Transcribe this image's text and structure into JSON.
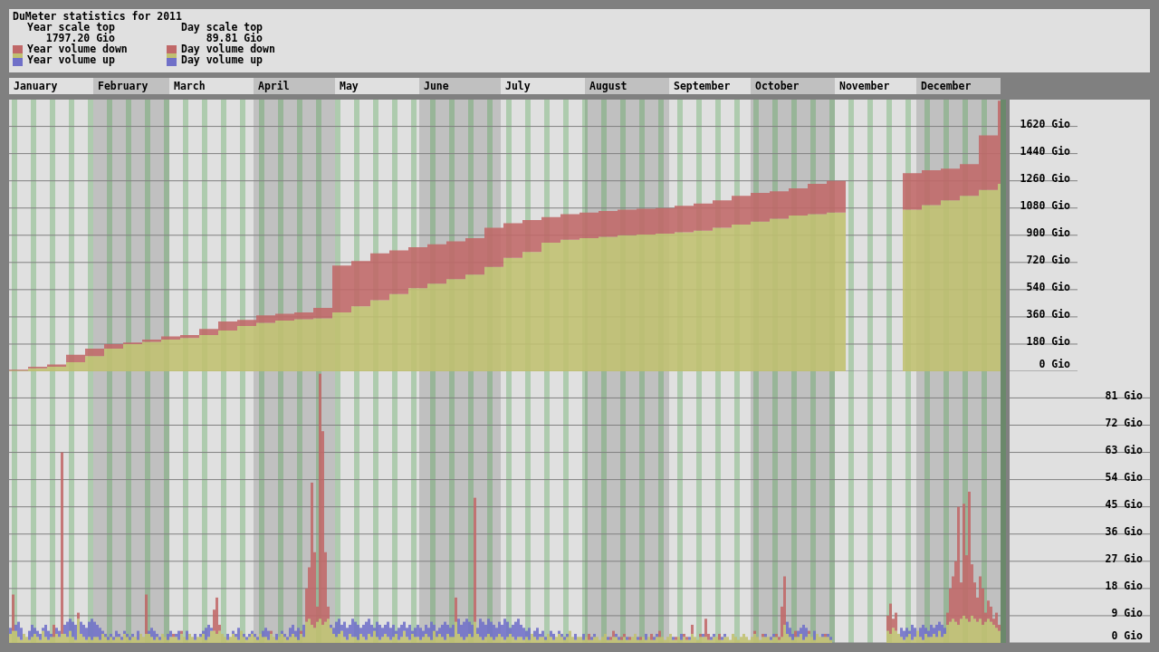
{
  "header": {
    "title": "DuMeter statistics for 2011",
    "columns": [
      {
        "scale_label": "Year scale top",
        "scale_value": "1797.20 Gio",
        "overlap": {
          "color": "#c0c070"
        },
        "legend": [
          {
            "label": "Year volume down",
            "color": "#c06868"
          },
          {
            "label": "Year volume up",
            "color": "#7070c8"
          }
        ]
      },
      {
        "scale_label": "Day scale top",
        "scale_value": "89.81 Gio",
        "overlap": {
          "color": "#c0c070"
        },
        "legend": [
          {
            "label": "Day volume down",
            "color": "#c06868"
          },
          {
            "label": "Day volume up",
            "color": "#7070c8"
          }
        ]
      }
    ]
  },
  "months": [
    "January",
    "February",
    "March",
    "April",
    "May",
    "June",
    "July",
    "August",
    "September",
    "October",
    "November",
    "December"
  ],
  "year_chart": {
    "axis_labels": [
      "1620 Gio",
      "1440 Gio",
      "1260 Gio",
      "1080 Gio",
      "900 Gio",
      "720 Gio",
      "540 Gio",
      "360 Gio",
      "180 Gio",
      "0 Gio"
    ]
  },
  "day_chart": {
    "axis_labels": [
      "81 Gio",
      "72 Gio",
      "63 Gio",
      "54 Gio",
      "45 Gio",
      "36 Gio",
      "27 Gio",
      "18 Gio",
      "9 Gio",
      "0 Gio"
    ]
  }
}
